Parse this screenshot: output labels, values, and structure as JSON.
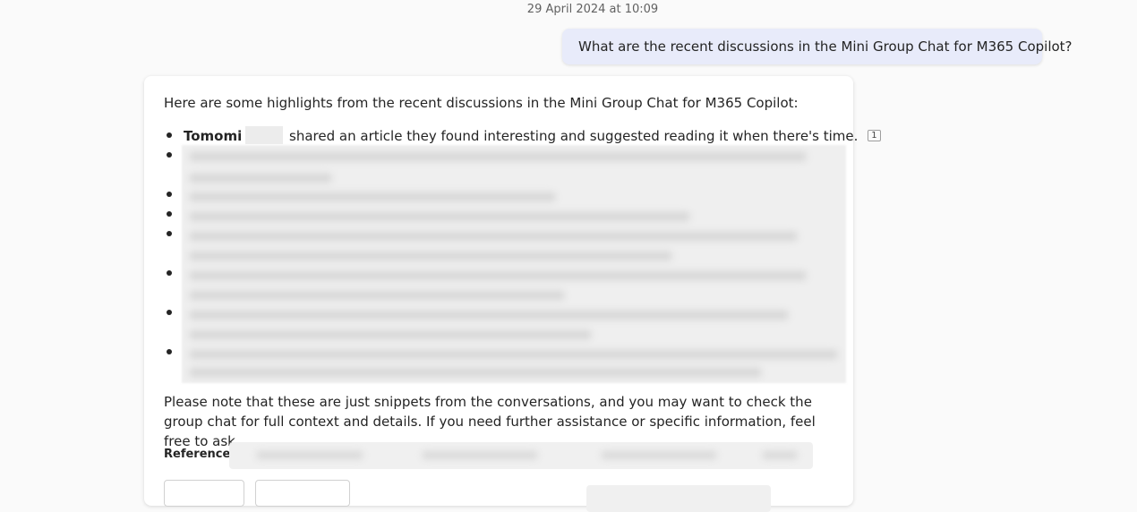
{
  "conversation": {
    "timestamp": "29 April 2024 at 10:09",
    "user_message": "What are the recent discussions in the Mini Group Chat for M365 Copilot?"
  },
  "response": {
    "intro": "Here are some highlights from the recent discussions in the Mini Group Chat for M365 Copilot:",
    "items": [
      {
        "name": "Tomomi",
        "text": "shared an article they found interesting and suggested reading it when there's time.",
        "reference": "1"
      }
    ],
    "closing": "Please note that these are just snippets from the conversations, and you may want to check the group chat for full context and details. If you need further assistance or specific information, feel free to ask.",
    "references_label": "References"
  },
  "colors": {
    "user_bubble": "#e8ebfa",
    "card": "#ffffff",
    "page_background": "#fafafa"
  }
}
